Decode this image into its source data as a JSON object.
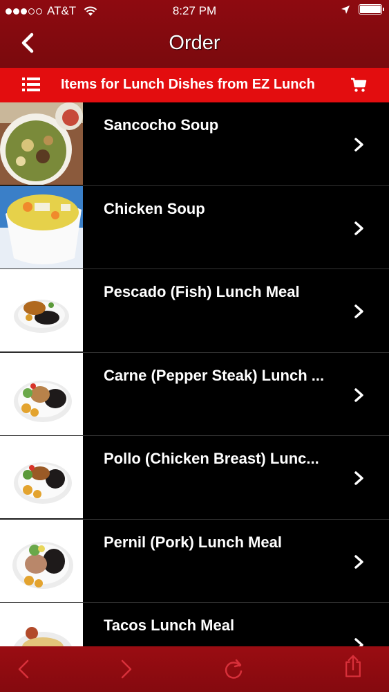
{
  "status_bar": {
    "carrier": "AT&T",
    "time": "8:27 PM",
    "signal_icon": "signal-dots-icon",
    "wifi_icon": "wifi-icon",
    "location_icon": "location-arrow-icon",
    "battery_icon": "battery-icon"
  },
  "nav": {
    "title": "Order",
    "back_icon": "chevron-left-icon"
  },
  "sub_header": {
    "title": "Items for Lunch Dishes from EZ Lunch",
    "list_icon": "list-icon",
    "cart_icon": "cart-icon"
  },
  "items": [
    {
      "label": "Sancocho Soup",
      "image": "sancocho-soup-photo"
    },
    {
      "label": "Chicken Soup",
      "image": "chicken-soup-photo"
    },
    {
      "label": "Pescado (Fish) Lunch Meal",
      "image": "fish-plate-photo"
    },
    {
      "label": "Carne (Pepper Steak) Lunch ...",
      "image": "steak-plate-photo"
    },
    {
      "label": "Pollo (Chicken Breast) Lunc...",
      "image": "chicken-plate-photo"
    },
    {
      "label": "Pernil (Pork) Lunch Meal",
      "image": "pork-plate-photo"
    },
    {
      "label": "Tacos Lunch Meal",
      "image": "tacos-plate-photo"
    }
  ],
  "toolbar": {
    "back_icon": "arrow-back-icon",
    "forward_icon": "arrow-forward-icon",
    "reload_icon": "reload-icon",
    "share_icon": "share-icon"
  },
  "colors": {
    "nav_red": "#8e0a10",
    "header_red": "#e30d0f",
    "list_bg": "#000000",
    "toolbar_icon": "#d8303a"
  }
}
